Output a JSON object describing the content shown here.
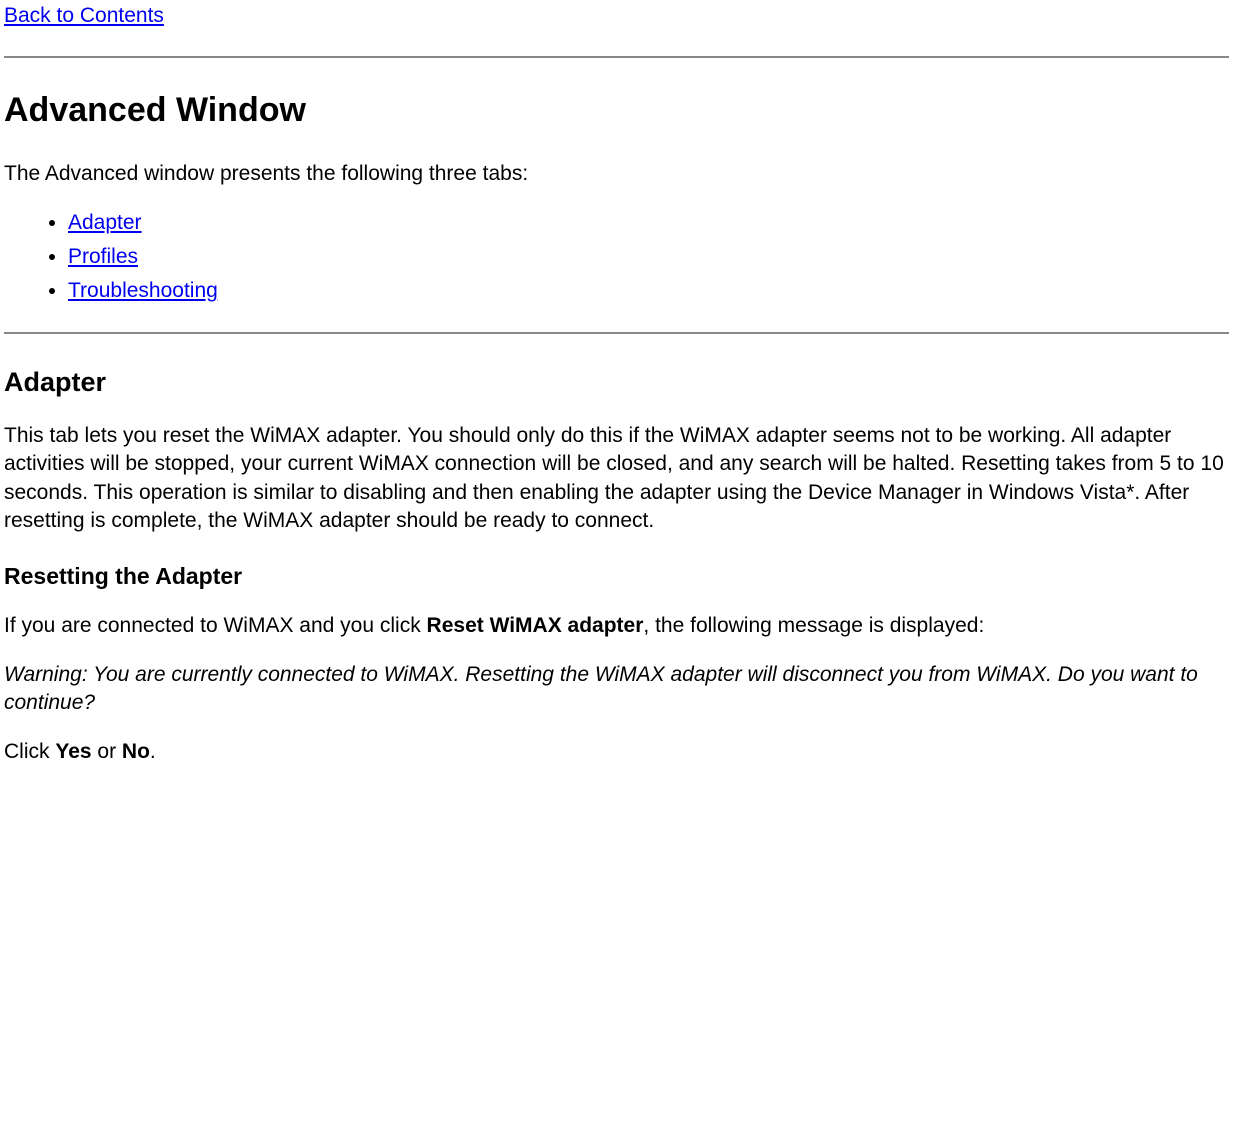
{
  "nav": {
    "back_to_contents": "Back to Contents"
  },
  "headings": {
    "advanced_window": "Advanced Window",
    "adapter": "Adapter",
    "resetting_the_adapter": "Resetting the Adapter"
  },
  "intro": {
    "tabs_sentence": "The Advanced window presents the following three tabs:"
  },
  "tabs_list": {
    "items": [
      {
        "label": "Adapter"
      },
      {
        "label": "Profiles"
      },
      {
        "label": "Troubleshooting"
      }
    ]
  },
  "adapter_section": {
    "description": "This tab lets you reset the WiMAX adapter. You should only do this if the WiMAX adapter seems not to be working. All adapter activities will be stopped, your current WiMAX connection will be closed, and any search will be halted. Resetting takes from 5 to 10 seconds. This operation is similar to disabling and then enabling the adapter using the Device Manager in Windows Vista*. After resetting is complete, the WiMAX adapter should be ready to connect."
  },
  "resetting_section": {
    "lead_in_pre": "If you are connected to WiMAX and you click ",
    "lead_in_bold": "Reset WiMAX adapter",
    "lead_in_post": ", the following message is displayed:",
    "warning_italic": "Warning: You are currently connected to WiMAX. Resetting the WiMAX adapter will disconnect you from WiMAX. Do you want to continue?",
    "click_pre": "Click ",
    "yes_label": "Yes",
    "or_text": " or ",
    "no_label": "No",
    "period": "."
  }
}
